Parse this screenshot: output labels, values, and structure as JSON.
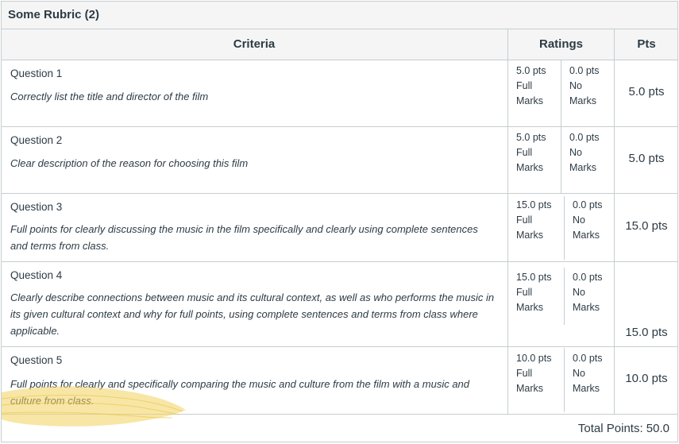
{
  "title": "Some Rubric (2)",
  "headers": {
    "criteria": "Criteria",
    "ratings": "Ratings",
    "pts": "Pts"
  },
  "rows": [
    {
      "question": "Question 1",
      "description": "Correctly list the title and director of the film",
      "ratings": [
        {
          "pts": "5.0 pts",
          "label1": "Full",
          "label2": "Marks"
        },
        {
          "pts": "0.0 pts",
          "label1": "No",
          "label2": "Marks"
        }
      ],
      "points": "5.0 pts"
    },
    {
      "question": "Question 2",
      "description": "Clear description of the reason for choosing this film",
      "ratings": [
        {
          "pts": "5.0 pts",
          "label1": "Full",
          "label2": "Marks"
        },
        {
          "pts": "0.0 pts",
          "label1": "No",
          "label2": "Marks"
        }
      ],
      "points": "5.0 pts"
    },
    {
      "question": "Question 3",
      "description": "Full points for clearly discussing the music in the film specifically and clearly using complete sentences and terms from class.",
      "ratings": [
        {
          "pts": "15.0 pts",
          "label1": "Full",
          "label2": "Marks"
        },
        {
          "pts": "0.0 pts",
          "label1": "No",
          "label2": "Marks"
        }
      ],
      "points": "15.0 pts"
    },
    {
      "question": "Question 4",
      "description": "Clearly describe connections between music and its cultural context, as well as who performs the music in its given cultural context and why for full points, using complete sentences and terms from class where applicable.",
      "ratings": [
        {
          "pts": "15.0 pts",
          "label1": "Full",
          "label2": "Marks"
        },
        {
          "pts": "0.0 pts",
          "label1": "No",
          "label2": "Marks"
        }
      ],
      "points": "15.0 pts"
    },
    {
      "question": "Question 5",
      "description": "Full points for clearly and specifically comparing the music and culture from the film with a music and culture from class.",
      "ratings": [
        {
          "pts": "10.0 pts",
          "label1": "Full",
          "label2": "Marks"
        },
        {
          "pts": "0.0 pts",
          "label1": "No",
          "label2": "Marks"
        }
      ],
      "points": "10.0 pts"
    }
  ],
  "total": "Total Points: 50.0",
  "colors": {
    "border": "#c7cdd1",
    "header_bg": "#f5f5f5",
    "text": "#2d3b45",
    "stamp": "#f2d15c"
  }
}
